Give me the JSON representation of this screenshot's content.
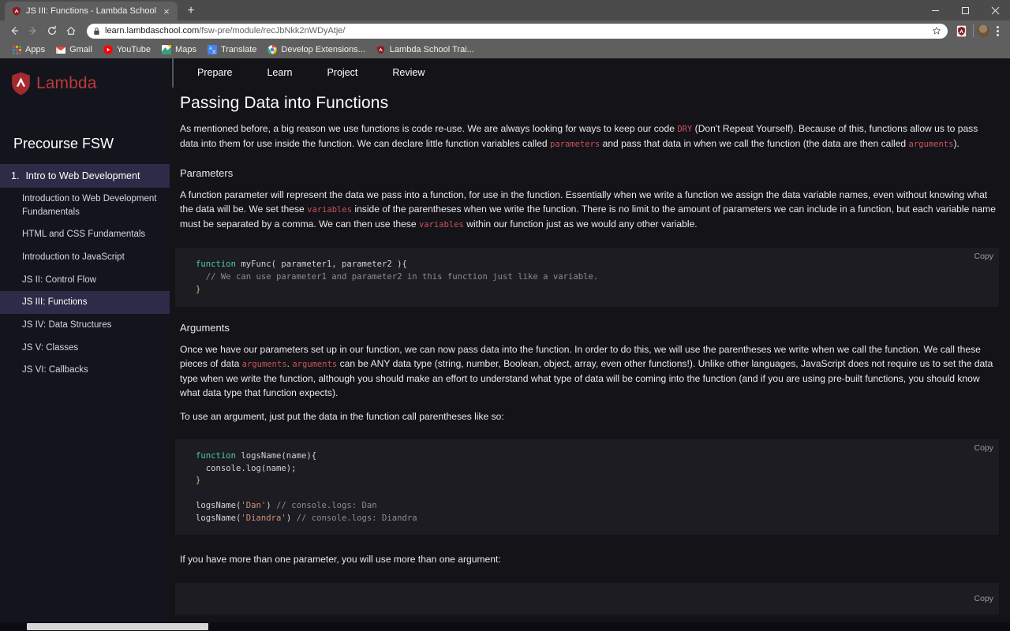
{
  "browser": {
    "tab": {
      "title": "JS III: Functions - Lambda School",
      "favicon": "lambda-shield-icon",
      "close": "×"
    },
    "newtab_label": "+",
    "window_controls": {
      "minimize": "minimize-icon",
      "maximize": "maximize-icon",
      "close": "close-icon"
    },
    "nav": {
      "back": "back-arrow-icon",
      "forward": "forward-arrow-icon",
      "reload": "reload-icon",
      "home": "home-icon"
    },
    "omnibox": {
      "lock": "lock-icon",
      "host": "learn.lambdaschool.com",
      "path": "/fsw-pre/module/recJbNkk2nWDyAtje/",
      "full_url": "learn.lambdaschool.com/fsw-pre/module/recJbNkk2nWDyAtje/",
      "star": "bookmark-star-icon"
    },
    "toolbar_extension": "lambda-extension-icon",
    "profile_avatar": "profile-avatar",
    "menu": "three-dot-menu-icon",
    "bookmarks": [
      {
        "label": "Apps",
        "icon": "apps-grid-icon"
      },
      {
        "label": "Gmail",
        "icon": "gmail-icon"
      },
      {
        "label": "YouTube",
        "icon": "youtube-icon"
      },
      {
        "label": "Maps",
        "icon": "maps-icon"
      },
      {
        "label": "Translate",
        "icon": "translate-icon"
      },
      {
        "label": "Develop Extensions...",
        "icon": "chrome-icon"
      },
      {
        "label": "Lambda School Trai...",
        "icon": "lambda-shield-icon"
      }
    ]
  },
  "sidebar": {
    "logo_text": "Lambda",
    "logo_icon": "lambda-shield-icon",
    "course_title": "Precourse FSW",
    "module": {
      "number": "1.",
      "label": "Intro to Web Development"
    },
    "items": [
      {
        "label": "Introduction to Web Development Fundamentals",
        "active": false
      },
      {
        "label": "HTML and CSS Fundamentals",
        "active": false
      },
      {
        "label": "Introduction to JavaScript",
        "active": false
      },
      {
        "label": "JS II: Control Flow",
        "active": false
      },
      {
        "label": "JS III: Functions",
        "active": true
      },
      {
        "label": "JS IV: Data Structures",
        "active": false
      },
      {
        "label": "JS V: Classes",
        "active": false
      },
      {
        "label": "JS VI: Callbacks",
        "active": false
      }
    ]
  },
  "topnav": {
    "tabs": [
      {
        "label": "Prepare"
      },
      {
        "label": "Learn"
      },
      {
        "label": "Project"
      },
      {
        "label": "Review"
      }
    ]
  },
  "main": {
    "title": "Passing Data into Functions",
    "intro": {
      "part1": "As mentioned before, a big reason we use functions is code re-use. We are always looking for ways to keep our code ",
      "code1": "DRY",
      "part2": " (Don't Repeat Yourself). Because of this, functions allow us to pass data into them for use inside the function. We can declare little function variables called ",
      "code2": "parameters",
      "part3": " and pass that data in when we call the function (the data are then called ",
      "code3": "arguments",
      "part4": ")."
    },
    "parameters_heading": "Parameters",
    "parameters_para": {
      "part1": "A function parameter will represent the data we pass into a function, for use in the function. Essentially when we write a function we assign the data variable names, even without knowing what the data will be. We set these ",
      "code1": "variables",
      "part2": " inside of the parentheses when we write the function. There is no limit to the amount of parameters we can include in a function, but each variable name must be separated by a comma. We can then use these ",
      "code2": "variables",
      "part3": " within our function just as we would any other variable."
    },
    "code_block_1": {
      "copy_label": "Copy",
      "lines": [
        {
          "tokens": [
            {
              "t": "function",
              "c": "k-kw"
            },
            {
              "t": " myFunc( parameter1, parameter2 ){",
              "c": "k-plain"
            }
          ]
        },
        {
          "tokens": [
            {
              "t": "  // We can use parameter1 and parameter2 in this function just like a variable.",
              "c": "k-com"
            }
          ]
        },
        {
          "tokens": [
            {
              "t": "}",
              "c": "k-brc"
            }
          ]
        }
      ]
    },
    "arguments_heading": "Arguments",
    "arguments_para": {
      "part1": "Once we have our parameters set up in our function, we can now pass data into the function. In order to do this, we will use the parentheses we write when we call the function. We call these pieces of data ",
      "code1": "arguments",
      "part2": ". ",
      "code2": "arguments",
      "part3": " can be ANY data type (string, number, Boolean, object, array, even other functions!). Unlike other languages, JavaScript does not require us to set the data type when we write the function, although you should make an effort to understand what type of data will be coming into the function (and if you are using pre-built functions, you should know what data type that function expects)."
    },
    "use_argument_para": "To use an argument, just put the data in the function call parentheses like so:",
    "code_block_2": {
      "copy_label": "Copy",
      "lines": [
        {
          "tokens": [
            {
              "t": "function",
              "c": "k-kw"
            },
            {
              "t": " logsName(name){",
              "c": "k-plain"
            }
          ]
        },
        {
          "tokens": [
            {
              "t": "  console.log(name);",
              "c": "k-plain"
            }
          ]
        },
        {
          "tokens": [
            {
              "t": "}",
              "c": "k-brc"
            }
          ]
        },
        {
          "tokens": [
            {
              "t": "",
              "c": "k-plain"
            }
          ]
        },
        {
          "tokens": [
            {
              "t": "logsName(",
              "c": "k-plain"
            },
            {
              "t": "'Dan'",
              "c": "k-str"
            },
            {
              "t": ") ",
              "c": "k-plain"
            },
            {
              "t": "// console.logs: Dan",
              "c": "k-com"
            }
          ]
        },
        {
          "tokens": [
            {
              "t": "logsName(",
              "c": "k-plain"
            },
            {
              "t": "'Diandra'",
              "c": "k-str"
            },
            {
              "t": ") ",
              "c": "k-plain"
            },
            {
              "t": "// console.logs: Diandra",
              "c": "k-com"
            }
          ]
        }
      ]
    },
    "more_params_para": "If you have more than one parameter, you will use more than one argument:",
    "code_block_3": {
      "copy_label": "Copy"
    }
  },
  "colors": {
    "accent_red": "#bd3a3a",
    "sidebar_bg": "#14141d",
    "sidebar_active": "#2d2b47",
    "content_bg": "#131318",
    "code_bg": "#1c1c22",
    "inline_code": "#c9545a"
  }
}
